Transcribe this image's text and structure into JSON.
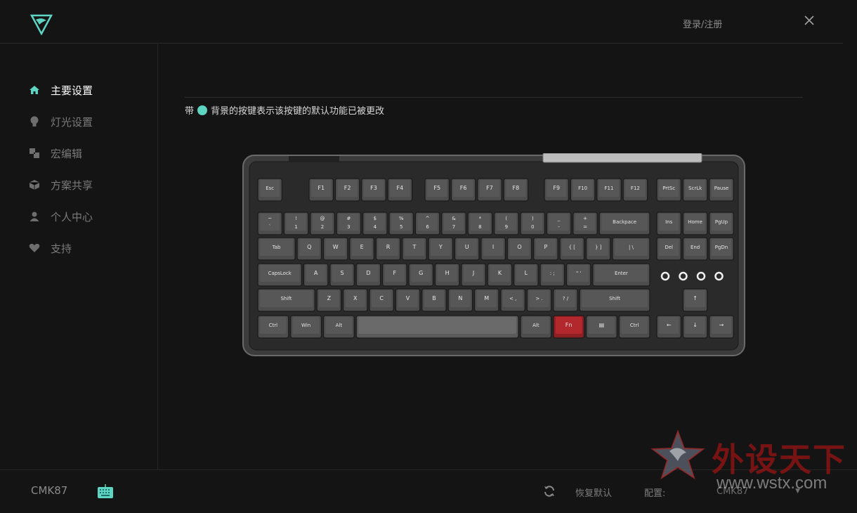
{
  "header": {
    "login_label": "登录/注册"
  },
  "sidebar": {
    "items": [
      {
        "label": "主要设置",
        "icon": "home-icon",
        "active": true
      },
      {
        "label": "灯光设置",
        "icon": "bulb-icon",
        "active": false
      },
      {
        "label": "宏编辑",
        "icon": "macro-icon",
        "active": false
      },
      {
        "label": "方案共享",
        "icon": "cube-icon",
        "active": false
      },
      {
        "label": "个人中心",
        "icon": "user-icon",
        "active": false
      },
      {
        "label": "支持",
        "icon": "heart-icon",
        "active": false
      }
    ]
  },
  "main": {
    "notice_prefix": "带",
    "notice_suffix": "背景的按键表示该按键的默认功能已被更改",
    "keyboard": {
      "row_f": [
        "Esc",
        "F1",
        "F2",
        "F3",
        "F4",
        "F5",
        "F6",
        "F7",
        "F8",
        "F9",
        "F10",
        "F11",
        "F12",
        "PrtSc",
        "ScrLk",
        "Pause"
      ],
      "row_num": [
        [
          "~",
          "`"
        ],
        [
          "!",
          "1"
        ],
        [
          "@",
          "2"
        ],
        [
          "#",
          "3"
        ],
        [
          "$",
          "4"
        ],
        [
          "%",
          "5"
        ],
        [
          "^",
          "6"
        ],
        [
          "&",
          "7"
        ],
        [
          "*",
          "8"
        ],
        [
          "(",
          "9"
        ],
        [
          ")",
          "0"
        ],
        [
          "_",
          "-"
        ],
        [
          "+",
          "="
        ],
        [
          "Backpace",
          ""
        ],
        [
          "Ins",
          ""
        ],
        [
          "Home",
          ""
        ],
        [
          "PgUp",
          ""
        ]
      ],
      "row_q": [
        "Tab",
        "Q",
        "W",
        "E",
        "R",
        "T",
        "Y",
        "U",
        "I",
        "O",
        "P",
        "{ [",
        "} ]",
        "| \\",
        "Del",
        "End",
        "PgDn"
      ],
      "row_a": [
        "CapsLock",
        "A",
        "S",
        "D",
        "F",
        "G",
        "H",
        "J",
        "K",
        "L",
        ": ;",
        "\" '",
        "Enter"
      ],
      "row_z": [
        "Shift",
        "Z",
        "X",
        "C",
        "V",
        "B",
        "N",
        "M",
        "< ,",
        "> .",
        "? /",
        "Shift",
        "↑"
      ],
      "row_b": [
        "Ctrl",
        "Win",
        "Alt",
        "",
        "Alt",
        "Fn",
        "▤",
        "Ctrl",
        "←",
        "↓",
        "→"
      ]
    }
  },
  "footer": {
    "device_name": "CMK87",
    "restore_label": "恢复默认",
    "config_label": "配置:",
    "config_value": "CMK87"
  },
  "watermark": {
    "cn": "外设天下",
    "en": "www.wstx.com"
  },
  "colors": {
    "accent": "#5ed4c3",
    "fn_key": "#b3282d",
    "bg": "#141414"
  }
}
